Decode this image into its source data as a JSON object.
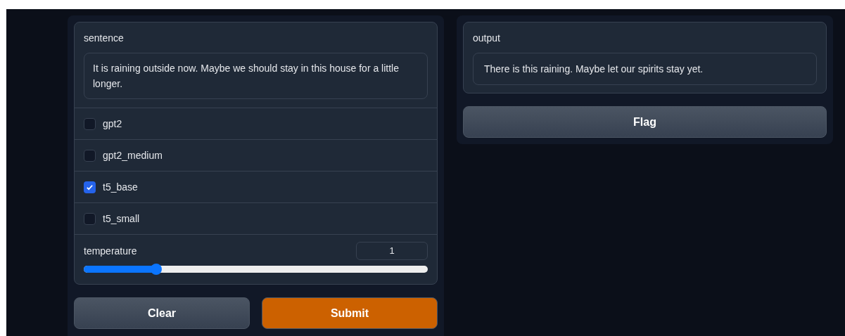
{
  "input_panel": {
    "sentence": {
      "label": "sentence",
      "value": "It is raining outside now. Maybe we should stay in this house for a little longer."
    },
    "models": [
      {
        "label": "gpt2",
        "checked": false
      },
      {
        "label": "gpt2_medium",
        "checked": false
      },
      {
        "label": "t5_base",
        "checked": true
      },
      {
        "label": "t5_small",
        "checked": false
      }
    ],
    "temperature": {
      "label": "temperature",
      "value": "1",
      "level": 0.21
    },
    "buttons": [
      {
        "label": "Clear",
        "kind": "secondary"
      },
      {
        "label": "Submit",
        "kind": "primary"
      }
    ]
  },
  "output_panel": {
    "output": {
      "label": "output",
      "value": "There is this raining. Maybe let our spirits stay yet."
    },
    "buttons": [
      {
        "label": "Flag",
        "kind": "secondary"
      }
    ]
  }
}
